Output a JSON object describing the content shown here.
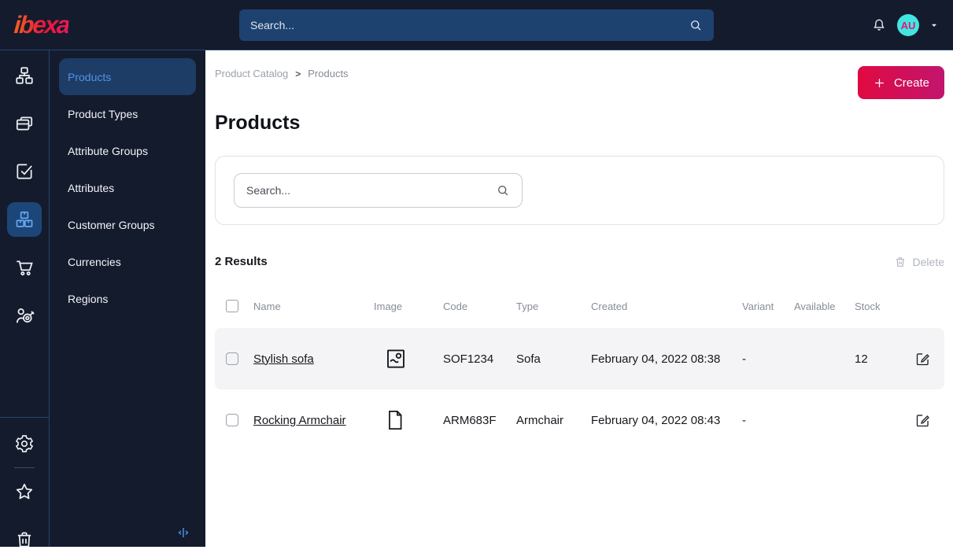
{
  "topbar": {
    "logo": "ibexa",
    "search_placeholder": "Search...",
    "avatar_initials": "AU"
  },
  "icon_rail": {
    "items": [
      {
        "icon": "sitemap-icon"
      },
      {
        "icon": "pages-icon"
      },
      {
        "icon": "tasks-icon"
      },
      {
        "icon": "product-catalog-icon",
        "active": true
      },
      {
        "icon": "cart-icon"
      },
      {
        "icon": "segments-icon"
      },
      {
        "icon": "settings-icon"
      },
      {
        "icon": "bookmarks-icon"
      },
      {
        "icon": "trash-icon"
      }
    ]
  },
  "sidebar": {
    "items": [
      {
        "label": "Products",
        "active": true
      },
      {
        "label": "Product Types",
        "active": false
      },
      {
        "label": "Attribute Groups",
        "active": false
      },
      {
        "label": "Attributes",
        "active": false
      },
      {
        "label": "Customer Groups",
        "active": false
      },
      {
        "label": "Currencies",
        "active": false
      },
      {
        "label": "Regions",
        "active": false
      }
    ]
  },
  "breadcrumb": {
    "items": [
      "Product Catalog",
      "Products"
    ],
    "sep": ">"
  },
  "page": {
    "title": "Products",
    "create_label": "Create"
  },
  "filter": {
    "search_placeholder": "Search..."
  },
  "results": {
    "count": "2 Results",
    "delete_label": "Delete"
  },
  "table": {
    "headers": [
      "Name",
      "Image",
      "Code",
      "Type",
      "Created",
      "Variant",
      "Available",
      "Stock"
    ],
    "rows": [
      {
        "name": "Stylish sofa",
        "image_icon": "image-icon",
        "code": "SOF1234",
        "type": "Sofa",
        "created": "February 04, 2022 08:38",
        "variant": "-",
        "available": true,
        "stock": "12"
      },
      {
        "name": "Rocking Armchair",
        "image_icon": "file-icon",
        "code": "ARM683F",
        "type": "Armchair",
        "created": "February 04, 2022 08:43",
        "variant": "-",
        "available": false,
        "stock": ""
      }
    ]
  },
  "colors": {
    "topbar_bg": "#141b2d",
    "accent_blue": "#5093e9",
    "brand_gradient_start": "#e00a41",
    "brand_gradient_end": "#c2156e",
    "available_green": "#0fa52e",
    "unavailable_gray": "#b4b8c0",
    "avatar_bg": "#41e6e0",
    "avatar_text": "#e5137b"
  }
}
